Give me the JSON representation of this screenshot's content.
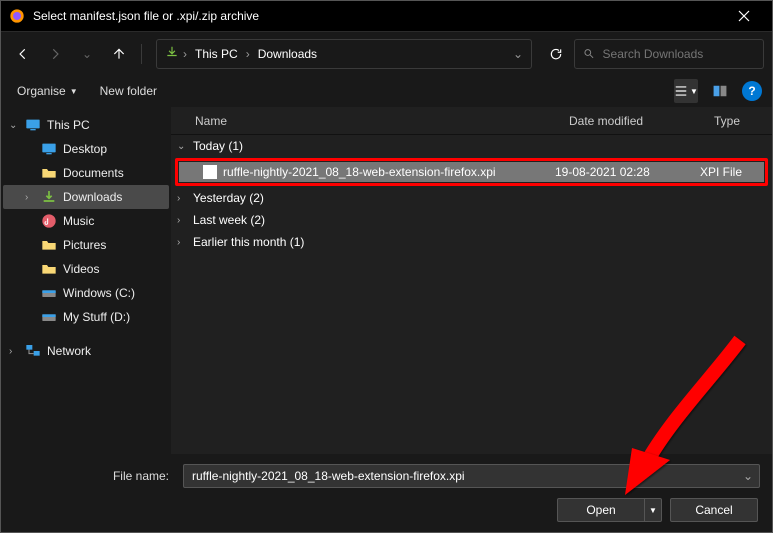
{
  "window": {
    "title": "Select manifest.json file or .xpi/.zip archive"
  },
  "nav": {
    "breadcrumb": [
      "This PC",
      "Downloads"
    ],
    "search_placeholder": "Search Downloads"
  },
  "toolbar": {
    "organise": "Organise",
    "new_folder": "New folder"
  },
  "sidebar": {
    "root": "This PC",
    "items": [
      {
        "label": "Desktop",
        "icon": "monitor"
      },
      {
        "label": "Documents",
        "icon": "folder"
      },
      {
        "label": "Downloads",
        "icon": "download",
        "selected": true
      },
      {
        "label": "Music",
        "icon": "music"
      },
      {
        "label": "Pictures",
        "icon": "folder"
      },
      {
        "label": "Videos",
        "icon": "folder"
      },
      {
        "label": "Windows (C:)",
        "icon": "drive"
      },
      {
        "label": "My Stuff (D:)",
        "icon": "drive"
      }
    ],
    "network": "Network"
  },
  "columns": {
    "name": "Name",
    "date": "Date modified",
    "type": "Type"
  },
  "groups": [
    {
      "label": "Today (1)",
      "expanded": true,
      "files": [
        {
          "name": "ruffle-nightly-2021_08_18-web-extension-firefox.xpi",
          "date": "19-08-2021 02:28",
          "type": "XPI File",
          "selected": true,
          "highlight": true
        }
      ]
    },
    {
      "label": "Yesterday (2)",
      "expanded": false,
      "files": []
    },
    {
      "label": "Last week (2)",
      "expanded": false,
      "files": []
    },
    {
      "label": "Earlier this month (1)",
      "expanded": false,
      "files": []
    }
  ],
  "footer": {
    "file_name_label": "File name:",
    "file_name_value": "ruffle-nightly-2021_08_18-web-extension-firefox.xpi",
    "open": "Open",
    "cancel": "Cancel"
  }
}
